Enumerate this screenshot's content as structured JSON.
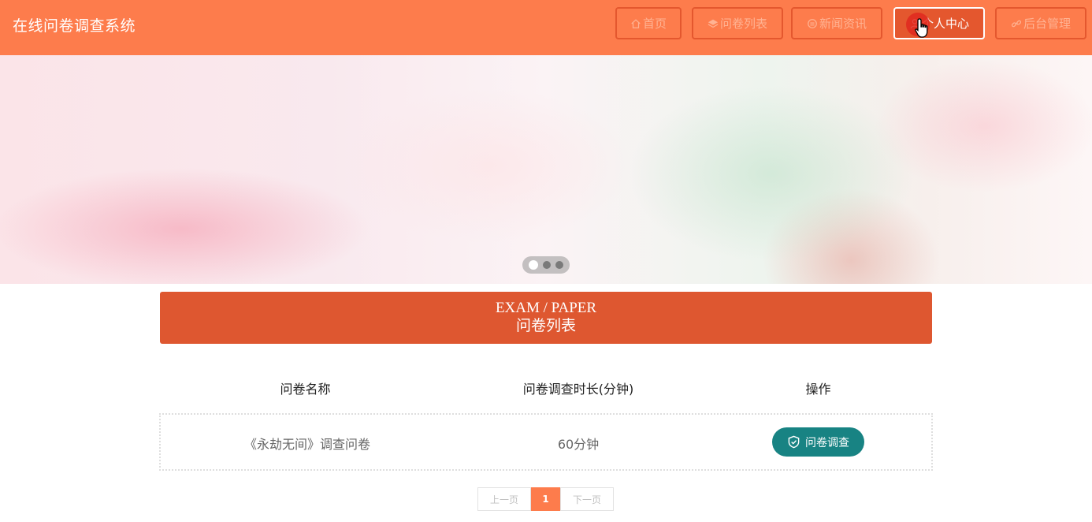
{
  "header": {
    "site_title": "在线问卷调查系统",
    "nav": [
      {
        "label": "首页",
        "icon": "home-icon"
      },
      {
        "label": "问卷列表",
        "icon": "layers-icon"
      },
      {
        "label": "新闻资讯",
        "icon": "news-icon"
      },
      {
        "label": "个人中心",
        "icon": "user-icon",
        "active": true
      },
      {
        "label": "后台管理",
        "icon": "link-icon"
      }
    ]
  },
  "banner": {
    "slides": 3,
    "active_slide": 1
  },
  "section": {
    "title_en": "EXAM / PAPER",
    "title_cn": "问卷列表"
  },
  "table": {
    "headers": [
      "问卷名称",
      "问卷调查时长(分钟)",
      "操作"
    ],
    "rows": [
      {
        "name": "《永劫无间》调查问卷",
        "duration": "60分钟",
        "action": "问卷调查"
      }
    ]
  },
  "pagination": {
    "prev": "上一页",
    "current": "1",
    "next": "下一页"
  },
  "colors": {
    "header": "#fd7c4c",
    "accent": "#de5730",
    "action": "#188383"
  }
}
